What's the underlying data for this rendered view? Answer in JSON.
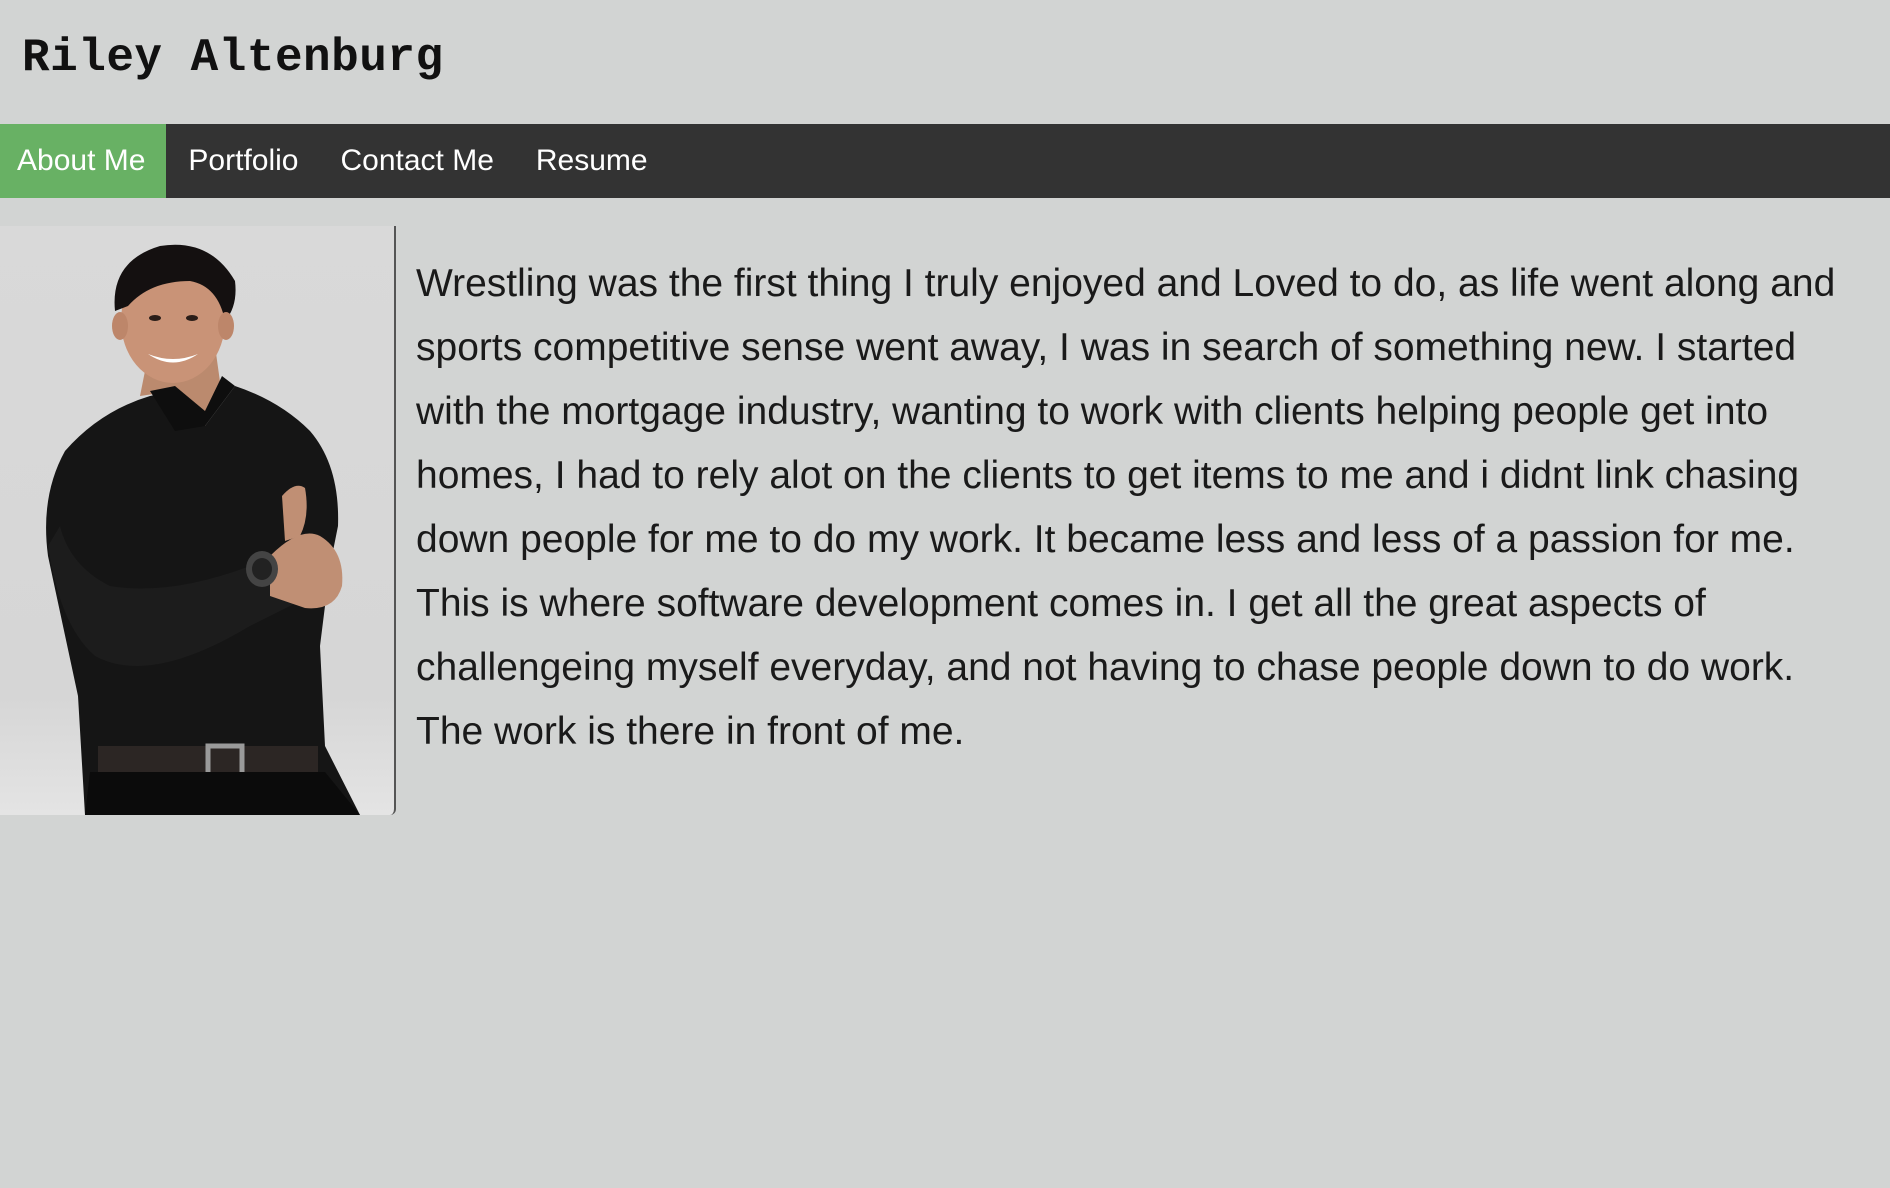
{
  "header": {
    "title": "Riley Altenburg"
  },
  "nav": {
    "items": [
      {
        "label": "About Me",
        "active": true
      },
      {
        "label": "Portfolio",
        "active": false
      },
      {
        "label": "Contact Me",
        "active": false
      },
      {
        "label": "Resume",
        "active": false
      }
    ]
  },
  "about": {
    "bio": "Wrestling was the first thing I truly enjoyed and Loved to do, as life went along and sports competitive sense went away, I was in search of something new. I started with the mortgage industry, wanting to work with clients helping people get into homes, I had to rely alot on the clients to get items to me and i didnt link chasing down people for me to do my work. It became less and less of a passion for me. This is where software development comes in. I get all the great aspects of challengeing myself everyday, and not having to chase people down to do work. The work is there in front of me."
  },
  "colors": {
    "page_background": "#d2d4d3",
    "nav_background": "#333333",
    "nav_active": "#68b164",
    "nav_text": "#ffffff"
  }
}
